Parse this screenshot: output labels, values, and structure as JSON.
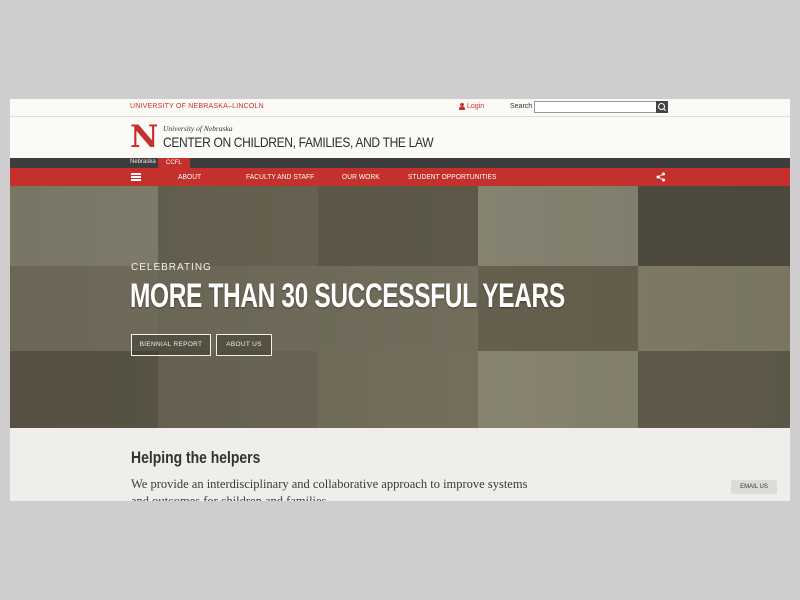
{
  "utility": {
    "university_link": "UNIVERSITY OF NEBRASKA–LINCOLN",
    "login_label": "Login",
    "search_label": "Search",
    "search_placeholder": ""
  },
  "header": {
    "logo_letter": "N",
    "subtitle": "University of Nebraska",
    "title": "CENTER ON CHILDREN, FAMILIES, AND THE LAW"
  },
  "breadcrumbs": [
    "Nebraska",
    "CCFL"
  ],
  "nav": {
    "items": [
      "ABOUT",
      "FACULTY AND STAFF",
      "OUR WORK",
      "STUDENT OPPORTUNITIES"
    ]
  },
  "hero": {
    "eyebrow": "CELEBRATING",
    "title": "MORE THAN 30 SUCCESSFUL YEARS",
    "buttons": [
      "BIENNIAL REPORT",
      "ABOUT US"
    ]
  },
  "content": {
    "heading": "Helping the helpers",
    "intro": "We provide an interdisciplinary and collaborative approach to improve systems and outcomes for children and families."
  },
  "email_button": "EMAIL US",
  "colors": {
    "brand_red": "#c4312c",
    "dark_bar": "#3d3d3d",
    "background": "#efeeea"
  }
}
